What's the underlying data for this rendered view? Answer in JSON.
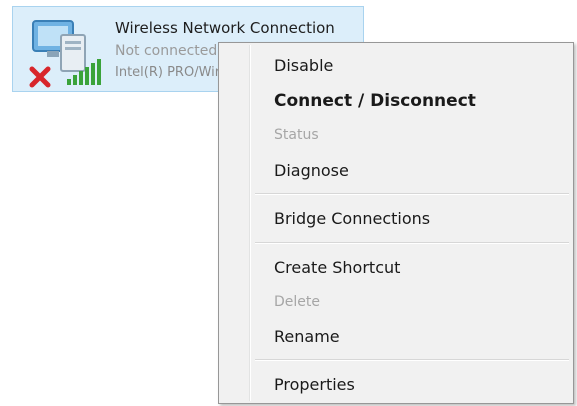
{
  "connection": {
    "name": "Wireless Network Connection",
    "status": "Not connected",
    "device": "Intel(R) PRO/Wireless",
    "icons": [
      "network-computer-icon",
      "disconnected-x-icon",
      "signal-bars-icon"
    ],
    "colors": {
      "tile_background": "#dceefa",
      "disconnected_x": "#d8262b",
      "signal_bars": "#3aa33a"
    }
  },
  "context_menu": {
    "items": [
      {
        "label": "Disable",
        "state": "enabled"
      },
      {
        "label": "Connect / Disconnect",
        "state": "default"
      },
      {
        "label": "Status",
        "state": "disabled"
      },
      {
        "label": "Diagnose",
        "state": "enabled"
      },
      {
        "label": "Bridge Connections",
        "state": "enabled"
      },
      {
        "label": "Create Shortcut",
        "state": "enabled"
      },
      {
        "label": "Delete",
        "state": "disabled"
      },
      {
        "label": "Rename",
        "state": "enabled"
      },
      {
        "label": "Properties",
        "state": "enabled"
      }
    ]
  }
}
